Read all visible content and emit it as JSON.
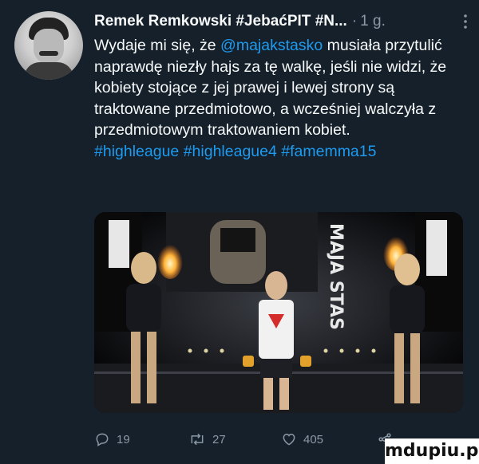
{
  "tweet": {
    "author_name": "Remek Remkowski #JebaćPIT #N...",
    "separator": "·",
    "time": "1 g.",
    "text_part1": "Wydaje mi się, że ",
    "mention": "@majakstasko",
    "text_part2": " musiała przytulić naprawdę niezły hajs za tę walkę, jeśli nie widzi, że kobiety stojące z jej prawej i lewej strony są traktowane przedmiotowo, a wcześniej walczyła z przedmiotowym traktowaniem kobiet.",
    "hashtags": [
      "#highleague",
      "#highleague4",
      "#famemma15"
    ],
    "image_text_right": "MAJA STAS",
    "stats": {
      "replies": "19",
      "retweets": "27",
      "likes": "405"
    }
  },
  "icons": {
    "more": "more-vertical-icon",
    "reply": "reply-icon",
    "retweet": "retweet-icon",
    "like": "heart-icon",
    "share": "share-icon"
  },
  "colors": {
    "background": "#15202b",
    "text": "#f7f9f9",
    "secondary": "#8b98a5",
    "accent": "#1d9bf0"
  },
  "watermark": "mdupiu.pl"
}
